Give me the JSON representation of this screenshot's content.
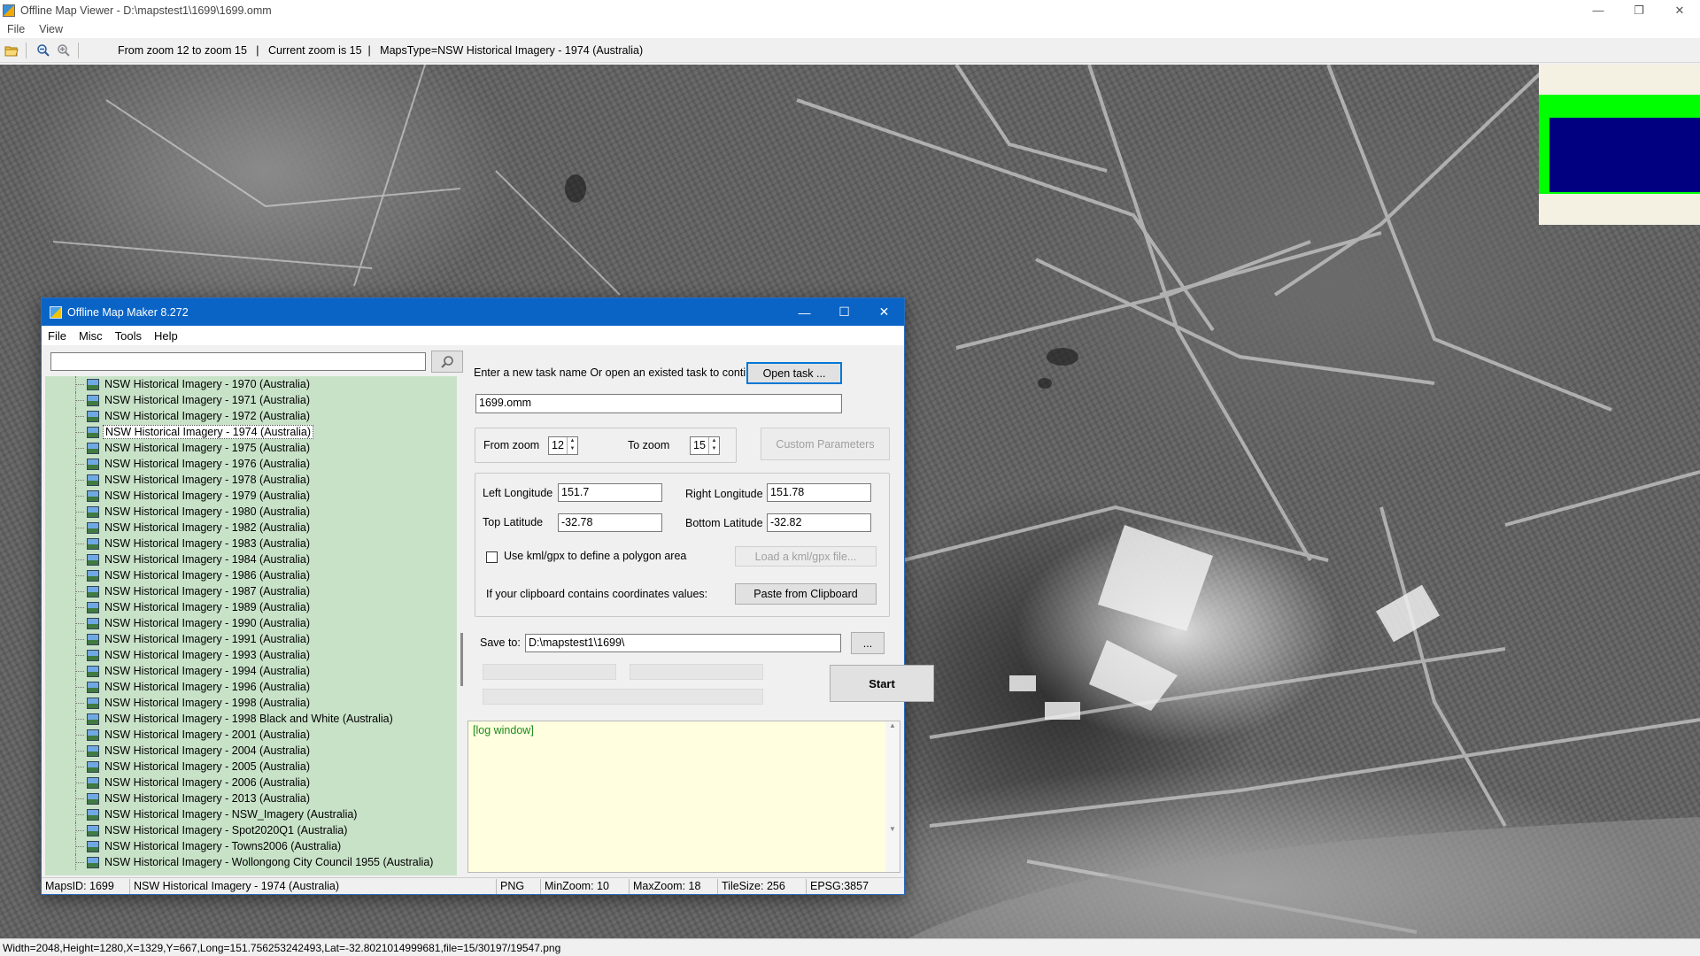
{
  "main_window": {
    "title": "Offline Map Viewer - D:\\mapstest1\\1699\\1699.omm",
    "controls": {
      "minimize": "—",
      "restore": "❐",
      "close": "✕"
    },
    "menu": [
      "File",
      "View"
    ],
    "toolbar": {
      "icons": [
        "open-folder-icon",
        "zoom-out-icon",
        "zoom-in-icon"
      ],
      "info": "From zoom 12 to zoom 15   |   Current zoom is 15  |   MapsType=NSW Historical Imagery - 1974 (Australia)"
    },
    "status": "Width=2048,Height=1280,X=1329,Y=667,Long=151.756253242493,Lat=-32.8021014999681,file=15/30197/19547.png"
  },
  "dialog": {
    "title": "Offline Map Maker 8.272",
    "controls": {
      "minimize": "—",
      "maximize": "☐",
      "close": "✕"
    },
    "menu": [
      "File",
      "Misc",
      "Tools",
      "Help"
    ],
    "search": {
      "value": "",
      "icon": "magnifier-icon"
    },
    "tree_items": [
      "NSW Historical Imagery - 1970 (Australia)",
      "NSW Historical Imagery - 1971 (Australia)",
      "NSW Historical Imagery - 1972 (Australia)",
      "NSW Historical Imagery - 1974 (Australia)",
      "NSW Historical Imagery - 1975 (Australia)",
      "NSW Historical Imagery - 1976 (Australia)",
      "NSW Historical Imagery - 1978 (Australia)",
      "NSW Historical Imagery - 1979 (Australia)",
      "NSW Historical Imagery - 1980 (Australia)",
      "NSW Historical Imagery - 1982 (Australia)",
      "NSW Historical Imagery - 1983 (Australia)",
      "NSW Historical Imagery - 1984 (Australia)",
      "NSW Historical Imagery - 1986 (Australia)",
      "NSW Historical Imagery - 1987 (Australia)",
      "NSW Historical Imagery - 1989 (Australia)",
      "NSW Historical Imagery - 1990 (Australia)",
      "NSW Historical Imagery - 1991 (Australia)",
      "NSW Historical Imagery - 1993 (Australia)",
      "NSW Historical Imagery - 1994 (Australia)",
      "NSW Historical Imagery - 1996 (Australia)",
      "NSW Historical Imagery - 1998 (Australia)",
      "NSW Historical Imagery - 1998 Black and White (Australia)",
      "NSW Historical Imagery - 2001 (Australia)",
      "NSW Historical Imagery - 2004 (Australia)",
      "NSW Historical Imagery - 2005 (Australia)",
      "NSW Historical Imagery - 2006 (Australia)",
      "NSW Historical Imagery - 2013 (Australia)",
      "NSW Historical Imagery - NSW_Imagery (Australia)",
      "NSW Historical Imagery - Spot2020Q1 (Australia)",
      "NSW Historical Imagery - Towns2006 (Australia)",
      "NSW Historical Imagery - Wollongong City Council 1955 (Australia)"
    ],
    "selected_index": 3,
    "task": {
      "prompt": "Enter a new task name Or open an existed task to continue:",
      "open_button": "Open task ...",
      "name": "1699.omm"
    },
    "zoom": {
      "from_label": "From zoom",
      "from_value": "12",
      "to_label": "To zoom",
      "to_value": "15",
      "custom_button": "Custom Parameters"
    },
    "coords": {
      "left_lon_label": "Left Longitude",
      "left_lon": "151.7",
      "right_lon_label": "Right Longitude",
      "right_lon": "151.78",
      "top_lat_label": "Top Latitude",
      "top_lat": "-32.78",
      "bottom_lat_label": "Bottom Latitude",
      "bottom_lat": "-32.82",
      "kml_label": "Use kml/gpx to define a polygon area",
      "kml_checked": false,
      "kml_button": "Load a kml/gpx file...",
      "clipboard_label": "If your clipboard contains coordinates values:",
      "clipboard_button": "Paste from Clipboard"
    },
    "save": {
      "label": "Save to:",
      "path": "D:\\mapstest1\\1699\\",
      "browse": "...",
      "start": "Start"
    },
    "log": "[log window]",
    "status": {
      "maps_id": "MapsID: 1699",
      "map_name": "NSW Historical Imagery - 1974 (Australia)",
      "format": "PNG",
      "min_zoom": "MinZoom: 10",
      "max_zoom": "MaxZoom: 18",
      "tile_size": "TileSize: 256",
      "epsg": "EPSG:3857"
    }
  }
}
